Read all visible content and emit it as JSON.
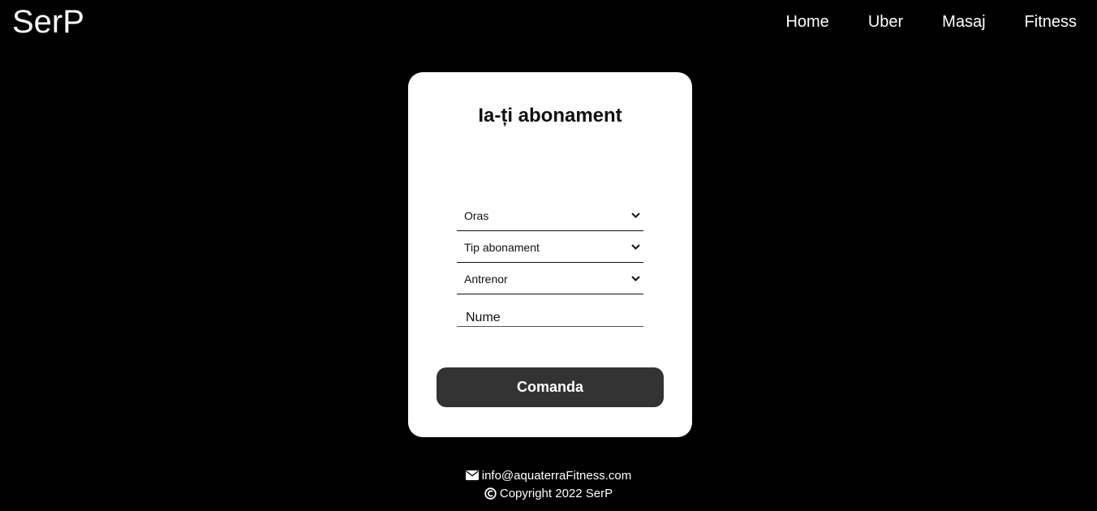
{
  "header": {
    "logo": "SerP",
    "nav": [
      "Home",
      "Uber",
      "Masaj",
      "Fitness"
    ]
  },
  "form": {
    "title": "Ia-ți abonament",
    "selects": {
      "oras": "Oras",
      "tip": "Tip abonament",
      "antrenor": "Antrenor"
    },
    "name_placeholder": "Nume",
    "submit_label": "Comanda"
  },
  "footer": {
    "email": "info@aquaterraFitness.com",
    "copyright": "Copyright 2022 SerP"
  },
  "colors": {
    "background": "#000000",
    "card": "#ffffff",
    "button": "#333333"
  },
  "icons": {
    "select_arrow": "chevron-down-icon",
    "email": "envelope-icon",
    "copyright": "copyright-icon"
  }
}
